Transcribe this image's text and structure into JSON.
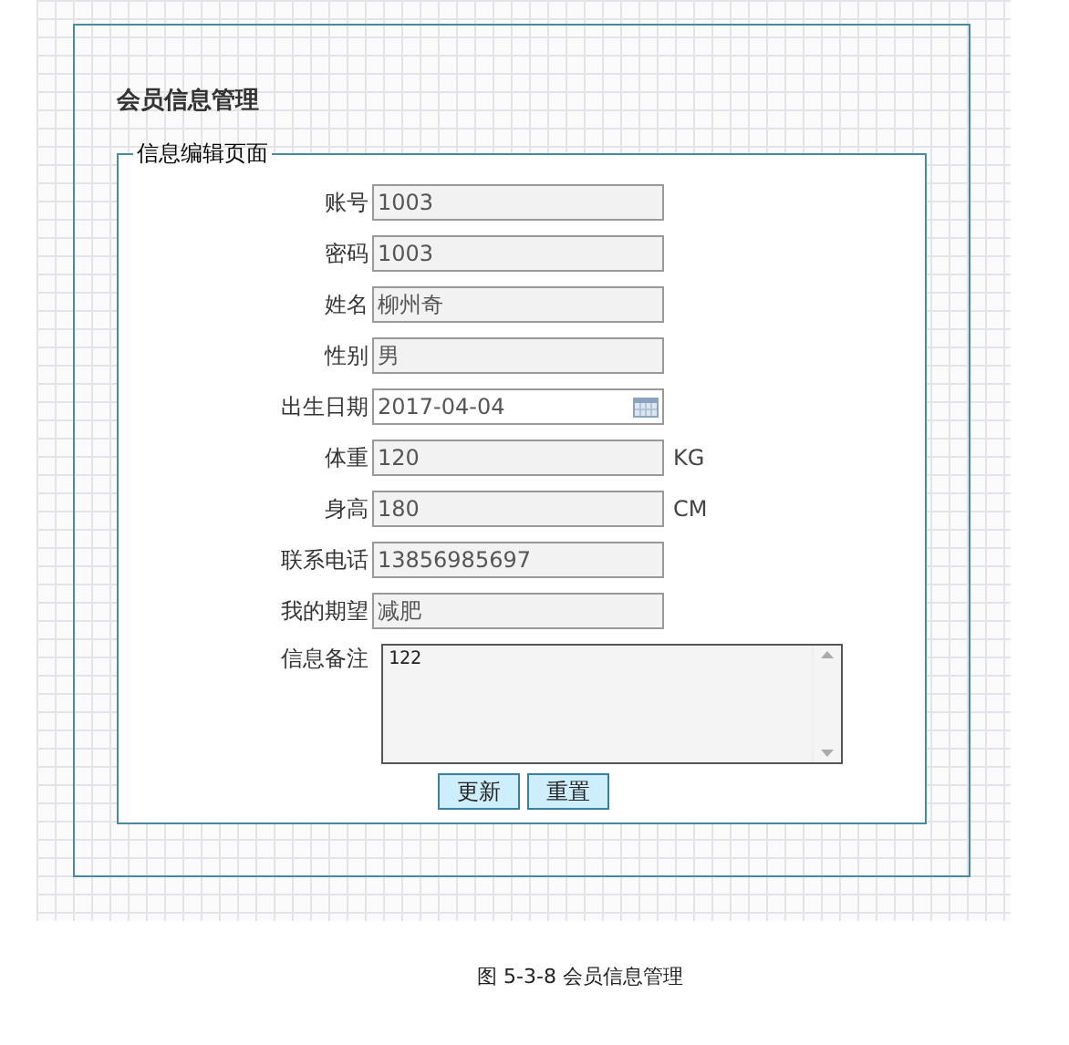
{
  "page_title": "会员信息管理",
  "form": {
    "legend": "信息编辑页面",
    "fields": [
      {
        "label": "账号",
        "value": "1003",
        "kind": "text"
      },
      {
        "label": "密码",
        "value": "1003",
        "kind": "text"
      },
      {
        "label": "姓名",
        "value": "柳州奇",
        "kind": "text"
      },
      {
        "label": "性别",
        "value": "男",
        "kind": "text"
      },
      {
        "label": "出生日期",
        "value": "2017-04-04",
        "kind": "date"
      },
      {
        "label": "体重",
        "value": "120",
        "kind": "text",
        "unit": "KG"
      },
      {
        "label": "身高",
        "value": "180",
        "kind": "text",
        "unit": "CM"
      },
      {
        "label": "联系电话",
        "value": "13856985697",
        "kind": "text"
      },
      {
        "label": "我的期望",
        "value": "减肥",
        "kind": "text"
      }
    ],
    "remarks": {
      "label": "信息备注",
      "value": "122"
    },
    "buttons": [
      "更新",
      "重置"
    ]
  },
  "caption": "图 5-3-8 会员信息管理"
}
